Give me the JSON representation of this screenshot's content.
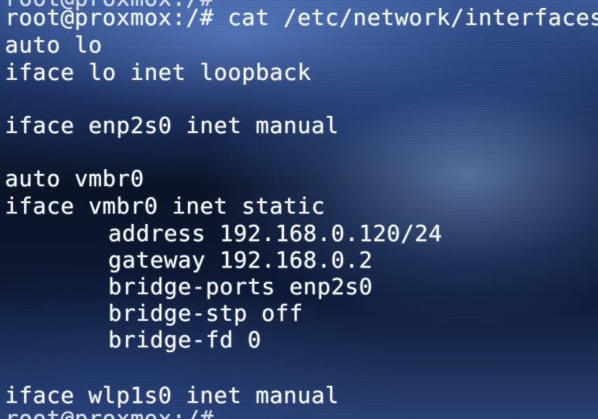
{
  "terminal": {
    "lines": {
      "prev_prompt_partial": "root@proxmox:/#",
      "prompt_command": "root@proxmox:/# cat /etc/network/interfaces",
      "l1": "auto lo",
      "l2": "iface lo inet loopback",
      "l3": "iface enp2s0 inet manual",
      "l4": "auto vmbr0",
      "l5": "iface vmbr0 inet static",
      "l6": "address 192.168.0.120/24",
      "l7": "gateway 192.168.0.2",
      "l8": "bridge-ports enp2s0",
      "l9": "bridge-stp off",
      "l10": "bridge-fd 0",
      "l11": "iface wlp1s0 inet manual",
      "next_prompt_partial": "root@proxmox:/#"
    }
  }
}
